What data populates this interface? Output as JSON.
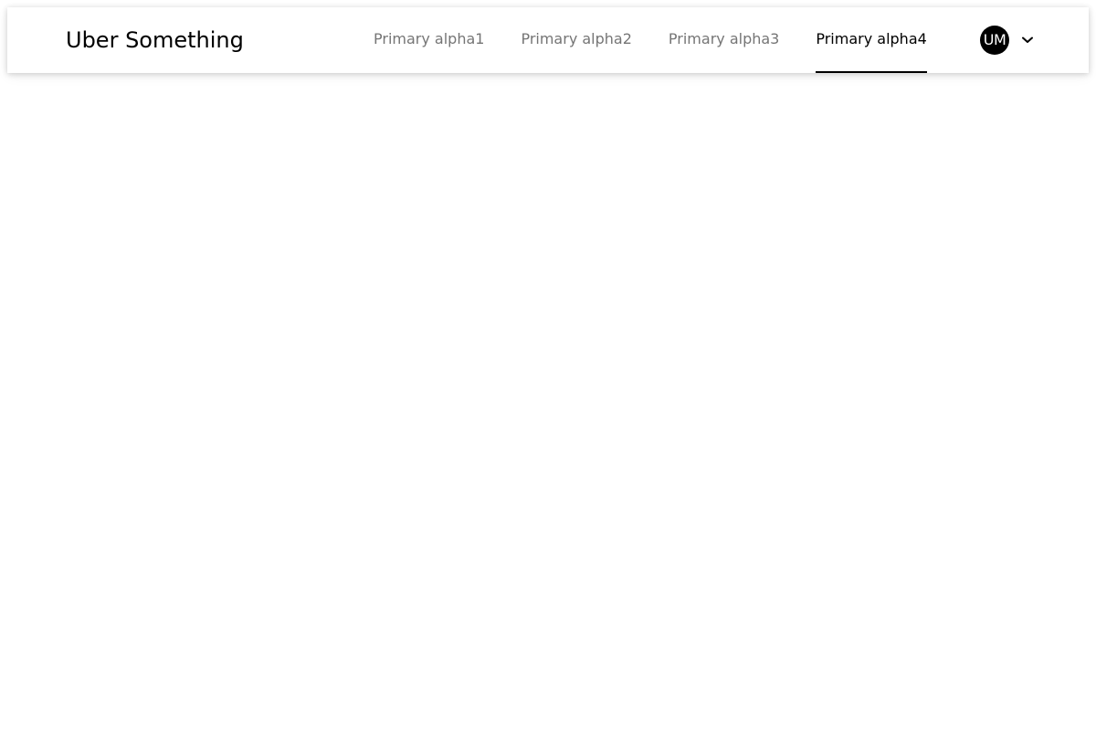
{
  "header": {
    "title": "Uber Something",
    "nav_items": [
      {
        "label": "Primary alpha1",
        "active": false
      },
      {
        "label": "Primary alpha2",
        "active": false
      },
      {
        "label": "Primary alpha3",
        "active": false
      },
      {
        "label": "Primary alpha4",
        "active": true
      }
    ],
    "user_menu": {
      "avatar_initials": "UM",
      "chevron_icon": "chevron-down-icon"
    }
  },
  "colors": {
    "active_text": "#000000",
    "inactive_text": "#757575",
    "avatar_bg": "#000000",
    "avatar_text": "#ffffff",
    "background": "#ffffff"
  }
}
